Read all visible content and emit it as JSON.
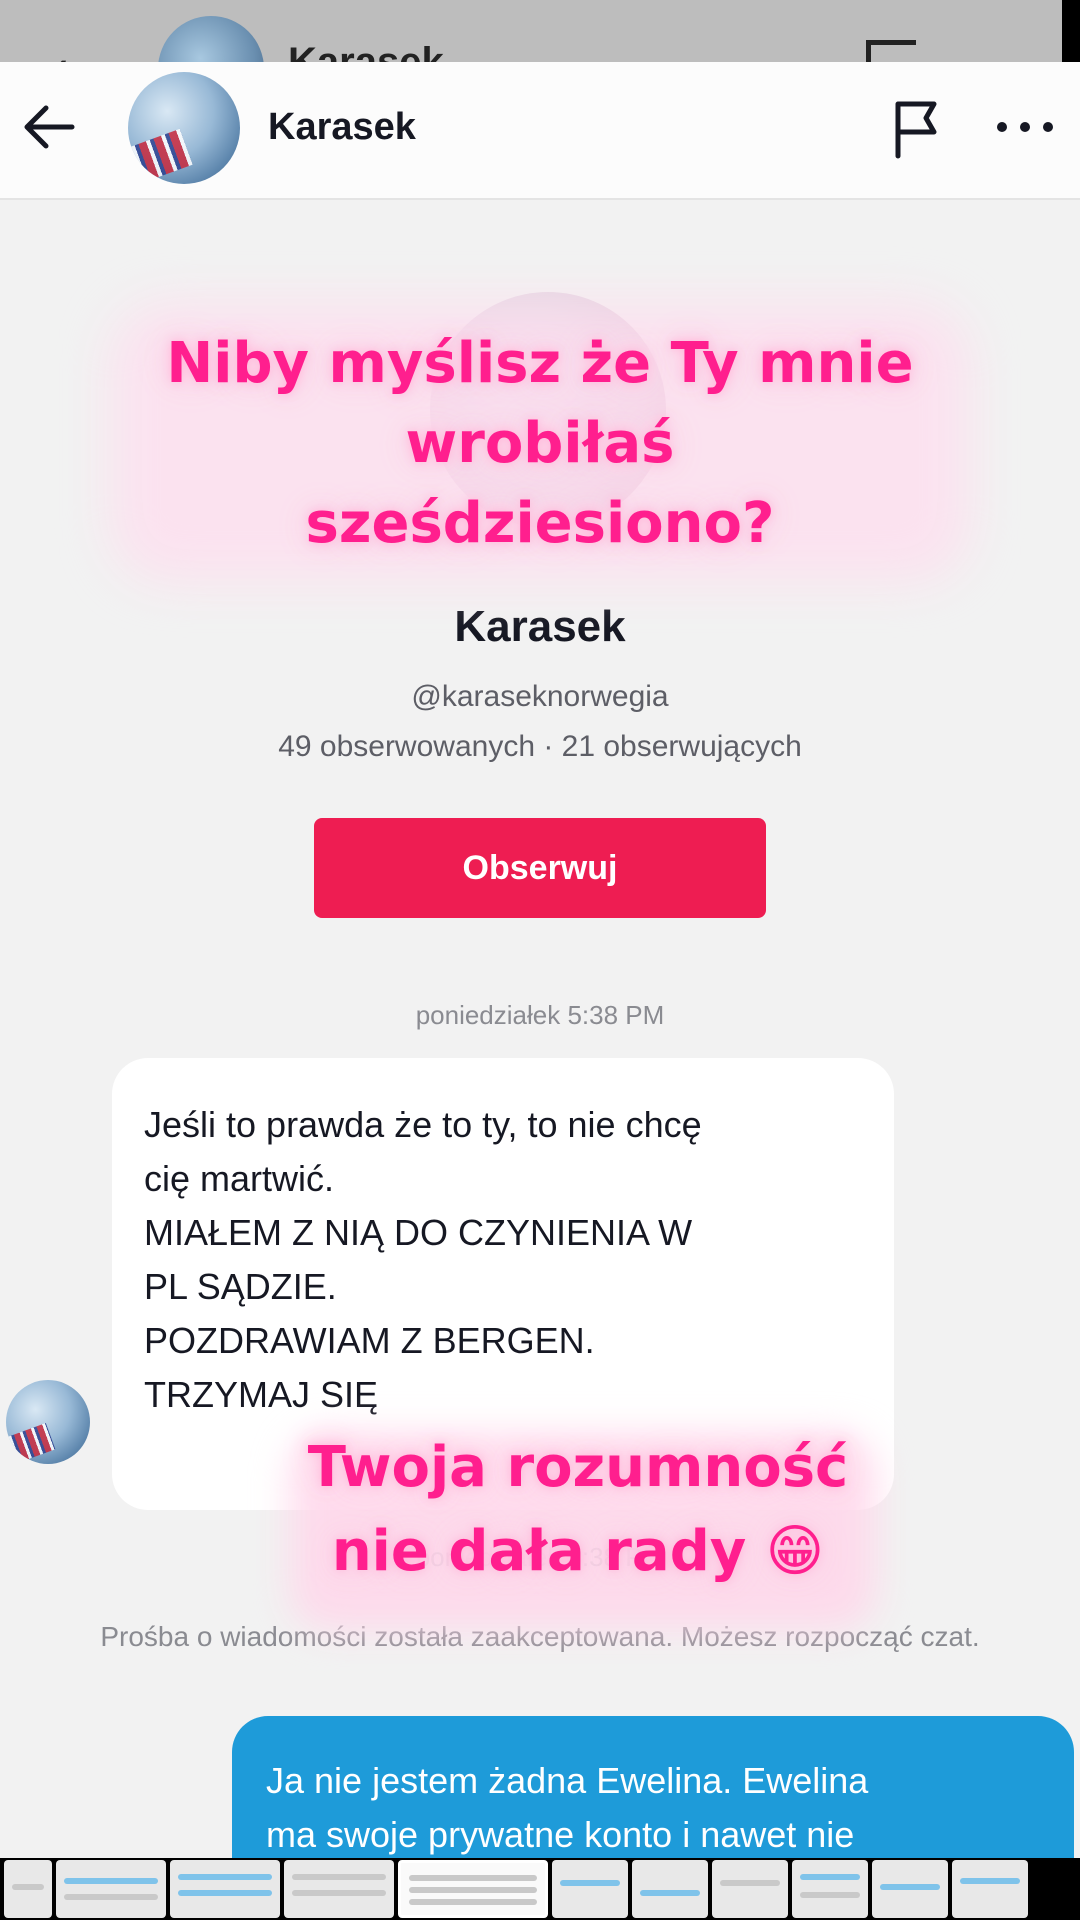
{
  "ghost_header": {
    "name": "Karasek"
  },
  "header": {
    "name": "Karasek"
  },
  "profile": {
    "name": "Karasek",
    "handle": "@karaseknorwegia",
    "stats": "49 obserwowanych · 21 obserwujących",
    "follow_label": "Obserwuj"
  },
  "chat": {
    "timestamp_1": "poniedziałek 5:38 PM",
    "incoming_lines": [
      "Jeśli to prawda że to ty, to nie chcę",
      "cię martwić.",
      "MIAŁEM Z NIĄ DO CZYNIENIA W",
      "PL SĄDZIE.",
      "POZDRAWIAM Z BERGEN.",
      "TRZYMAJ SIĘ"
    ],
    "timestamp_2": "poniedziałek 5:38 PM",
    "system_note": "Prośba o wiadomości została zaakceptowana. Możesz rozpocząć czat.",
    "outgoing_lines": [
      "Ja nie jestem żadna Ewelina. Ewelina",
      "ma swoje prywatne konto i nawet nie"
    ]
  },
  "captions": {
    "top_lines": [
      "Niby myślisz że Ty mnie",
      "wrobiłaś",
      "sześdziesiono?"
    ],
    "bottom_lines": [
      "Twoja rozumność",
      "nie dała rady 😁"
    ]
  },
  "colors": {
    "follow_button": "#ee1d52",
    "outgoing_bubble": "#1e9bd9",
    "caption_text": "#ff1f8e"
  },
  "icons": [
    "back-arrow-icon",
    "flag-icon",
    "more-dots-icon"
  ]
}
